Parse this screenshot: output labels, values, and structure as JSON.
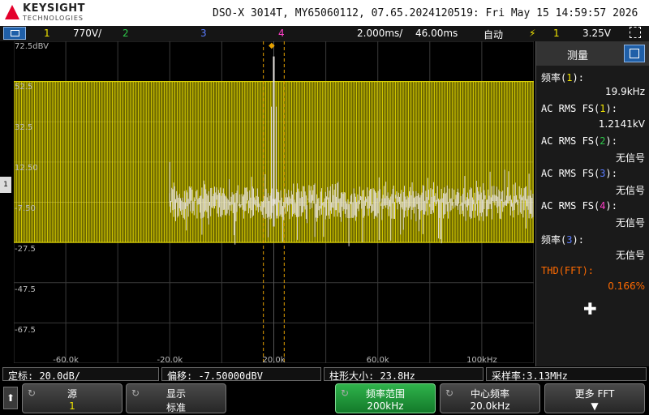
{
  "brand": {
    "name": "KEYSIGHT",
    "sub": "TECHNOLOGIES"
  },
  "device_info": "DSO-X 3014T, MY65060112, 07.65.2024120519: Fri May 15 14:59:57 2026",
  "channels": {
    "ch1_num": "1",
    "ch1_scale": "770V/",
    "ch2_num": "2",
    "ch3_num": "3",
    "ch4_num": "4",
    "timebase": "2.000ms/",
    "delay": "46.00ms",
    "trigger_mode": "自动",
    "trigger_icon": "trigger-edge-icon",
    "trigger_source": "1",
    "trigger_level": "3.25V"
  },
  "plot": {
    "y_labels": [
      "72.5dBV",
      "52.5",
      "32.5",
      "12.50",
      "-7.50",
      "-27.5",
      "-47.5",
      "-67.5"
    ],
    "x_labels": [
      "-60.0k",
      "-20.0k",
      "20.0k",
      "60.0k",
      "100kHz"
    ],
    "colors": {
      "trace": "#e8e4e0",
      "ch1": "#f2e600",
      "cursor": "#e6a100"
    },
    "signal_level_db": 52.5,
    "noise_floor_db": -7.5
  },
  "chart_data": {
    "type": "line",
    "title": "",
    "xlabel": "",
    "ylabel": "",
    "xlim": [
      -80000,
      120000
    ],
    "ylim": [
      -87.5,
      72.5
    ],
    "xticks": [
      -60000,
      -20000,
      20000,
      60000,
      100000
    ],
    "grid": true,
    "series": [
      {
        "peak_x": 20000,
        "peak_y": 65.0,
        "noise_floor": -7.5,
        "start_x": -20000
      }
    ]
  },
  "panel": {
    "title": "测量",
    "items": [
      {
        "label": "频率",
        "ch": "1",
        "ch_color": "c1",
        "value": "19.9kHz"
      },
      {
        "label": "AC RMS FS",
        "ch": "1",
        "ch_color": "c1",
        "value": "1.2141kV"
      },
      {
        "label": "AC RMS FS",
        "ch": "2",
        "ch_color": "c2",
        "value": "无信号"
      },
      {
        "label": "AC RMS FS",
        "ch": "3",
        "ch_color": "c3",
        "value": "无信号"
      },
      {
        "label": "AC RMS FS",
        "ch": "4",
        "ch_color": "c4",
        "value": "无信号"
      },
      {
        "label": "频率",
        "ch": "3",
        "ch_color": "c3",
        "value": "无信号"
      },
      {
        "label": "THD(FFT):",
        "ch": "",
        "ch_color": "",
        "value": "0.166%"
      }
    ]
  },
  "status": {
    "scale": "定标:  20.0dB/",
    "offset": "偏移:  -7.50000dBV",
    "bin": "柱形大小: 23.8Hz",
    "sample_rate": "采样率:3.13MHz"
  },
  "softkeys": [
    {
      "l1": "源",
      "l2": "1"
    },
    {
      "l1": "显示",
      "l2": "标准"
    },
    {
      "l1": "频率范围",
      "l2": "200kHz"
    },
    {
      "l1": "中心频率",
      "l2": "20.0kHz"
    },
    {
      "l1": "更多 FFT",
      "l2": ""
    }
  ]
}
